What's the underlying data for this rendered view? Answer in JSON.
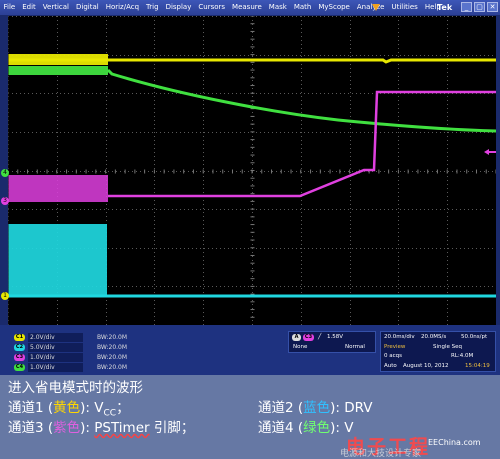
{
  "menu": {
    "items": [
      "File",
      "Edit",
      "Vertical",
      "Digital",
      "Horiz/Acq",
      "Trig",
      "Display",
      "Cursors",
      "Measure",
      "Mask",
      "Math",
      "MyScope",
      "Analyze",
      "Utilities",
      "Help"
    ],
    "brand": "Tek",
    "window_buttons": [
      "_",
      "▢",
      "✕"
    ]
  },
  "channels": [
    {
      "badge": "C1",
      "volts": "2.0V/div",
      "bandwidth": "BW:20.0M",
      "color": "#e8e800"
    },
    {
      "badge": "C2",
      "volts": "5.0V/div",
      "bandwidth": "BW:20.0M",
      "color": "#20d8e0"
    },
    {
      "badge": "C3",
      "volts": "1.0V/div",
      "bandwidth": "BW:20.0M",
      "color": "#e040e0"
    },
    {
      "badge": "C4",
      "volts": "1.0V/div",
      "bandwidth": "BW:20.0M",
      "color": "#40e040"
    }
  ],
  "trigger": {
    "badge_a": "A",
    "badge_ch": "C3",
    "slope": "╱",
    "level": "1.58V",
    "coupling": "None",
    "mode": "Normal"
  },
  "timebase": {
    "scale": "20.0ms/div",
    "sample_rate": "20.0MS/s",
    "resolution": "50.0ns/pt",
    "state": "Preview",
    "seq": "Single Seq",
    "acqs": "0 acqs",
    "record_length": "RL:4.0M",
    "trig_mode": "Auto",
    "date": "August 10, 2012",
    "time": "15:04:19"
  },
  "markers": {
    "ch4": "4",
    "ch3": "3",
    "ch1": "1"
  },
  "caption": {
    "line1": "进入省电模式时的波形",
    "line2a_prefix": "通道1 (",
    "line2a_color": "黄色",
    "line2a_suffix": "): V",
    "line2a_sub": "CC",
    "line2a_end": "；",
    "line2b_prefix": "通道2 (",
    "line2b_color": "蓝色",
    "line2b_suffix": "): DRV",
    "line3a_prefix": "通道3 (",
    "line3a_color": "紫色",
    "line3a_suffix": "): ",
    "line3a_signal": "PSTimer",
    "line3a_end": " 引脚；",
    "line3b_prefix": "通道4 (",
    "line3b_color": "绿色",
    "line3b_suffix": "): V"
  },
  "watermark": {
    "main": "电子工程",
    "sub": "电源和大技设计专家",
    "site": "EEChina.com"
  },
  "colors": {
    "ch1": "#e8e800",
    "ch2": "#20d8e0",
    "ch3": "#e040e0",
    "ch4": "#40e040",
    "grid": "#5a5a5a"
  }
}
